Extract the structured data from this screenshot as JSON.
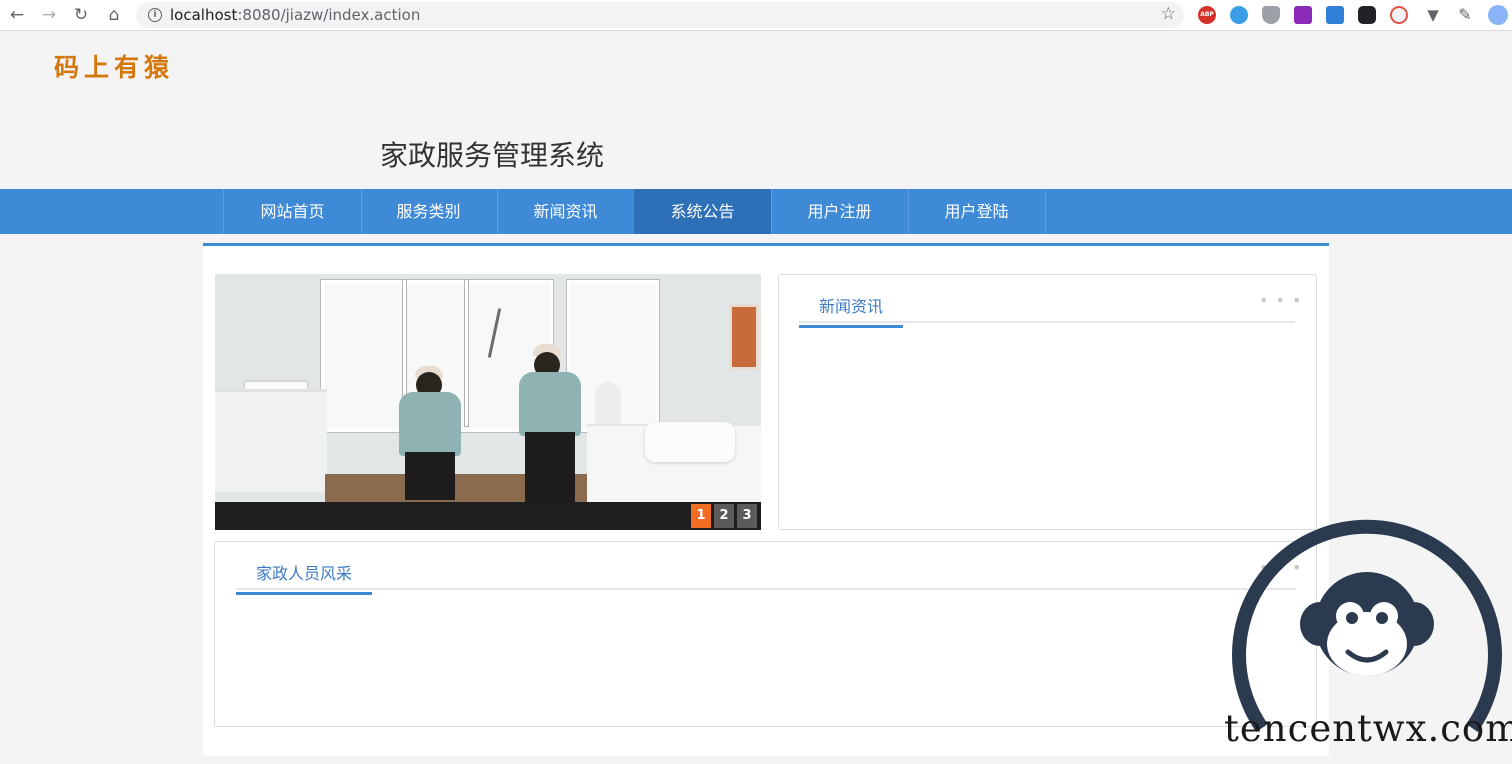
{
  "browser": {
    "url_host": "localhost",
    "url_rest": ":8080/jiazw/index.action",
    "icons": [
      "back-icon",
      "forward-icon",
      "reload-icon",
      "home-icon",
      "info-icon",
      "star-icon",
      "extensions-icon"
    ],
    "ext_abp_label": "ABP"
  },
  "header": {
    "logo": "码上有猿",
    "site_title": "家政服务管理系统"
  },
  "nav": {
    "items": [
      "网站首页",
      "服务类别",
      "新闻资讯",
      "系统公告",
      "用户注册",
      "用户登陆"
    ],
    "active_index": 3
  },
  "carousel": {
    "slides": [
      "1",
      "2",
      "3"
    ],
    "active_slide": "1"
  },
  "news_box": {
    "title": "新闻资讯",
    "more": "• • •"
  },
  "staff_box": {
    "title": "家政人员风采",
    "more": "• • •"
  },
  "watermark": {
    "text": "tencentwx.com"
  },
  "colors": {
    "nav_bg": "#3e8ad6",
    "nav_active": "#2d70b8",
    "logo": "#d4780d",
    "slide_active": "#f26c24",
    "box_title": "#3e7bc4"
  }
}
